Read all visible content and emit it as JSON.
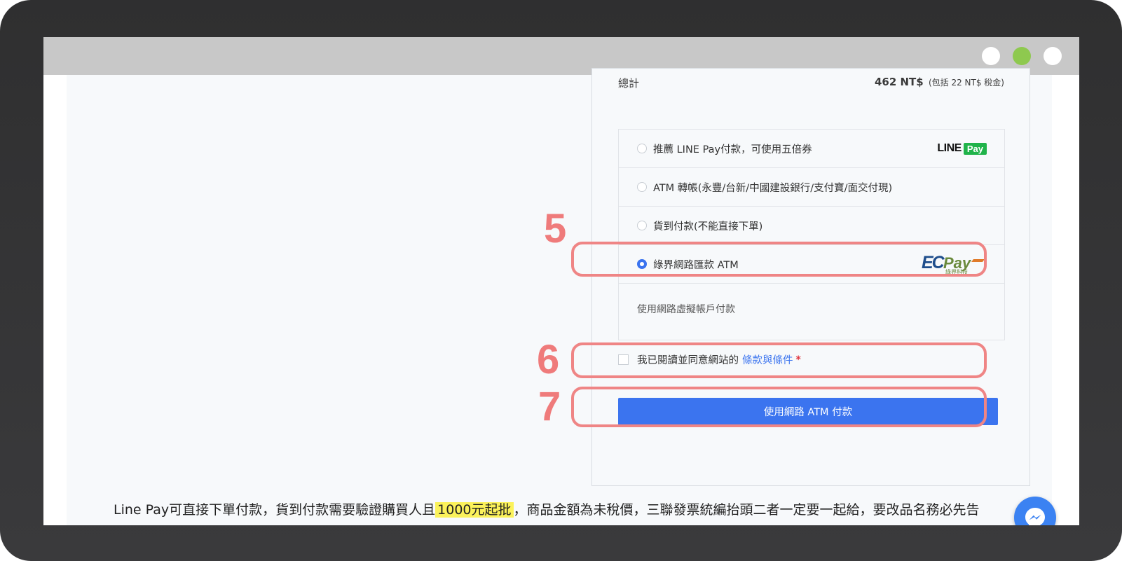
{
  "summary": {
    "total_label": "總計",
    "total_value": "462 NT$",
    "total_tax": "(包括 22 NT$ 稅金)"
  },
  "payment_methods": [
    {
      "label": "推薦 LINE Pay付款，可使用五倍券",
      "selected": false,
      "logo": "LINE Pay"
    },
    {
      "label": "ATM 轉帳(永豐/台新/中國建設銀行/支付寶/面交付現)",
      "selected": false
    },
    {
      "label": "貨到付款(不能直接下單)",
      "selected": false
    },
    {
      "label": "綠界網路匯款 ATM",
      "selected": true,
      "logo": "ECPay",
      "logo_sub": "綠界科技"
    }
  ],
  "method_description": "使用網路虛擬帳戶付款",
  "terms": {
    "text": "我已閱讀並同意網站的",
    "link": "條款與條件",
    "required_mark": "*"
  },
  "pay_button_label": "使用網路 ATM 付款",
  "annotations": [
    "5",
    "6",
    "7"
  ],
  "note": {
    "before": "Line Pay可直接下單付款，貨到付款需要驗證購買人且",
    "highlight": "1000元起批",
    "after": "，商品金額為未稅價，三聯發票統編抬頭二者一定要一起給，要改品名務必先告知。"
  },
  "colors": {
    "accent": "#3b74ef",
    "annotation": "#ef8585",
    "highlight": "#fbf25a",
    "linepay_green": "#20b34a",
    "titlebar_green_dot": "#8ec94f"
  }
}
